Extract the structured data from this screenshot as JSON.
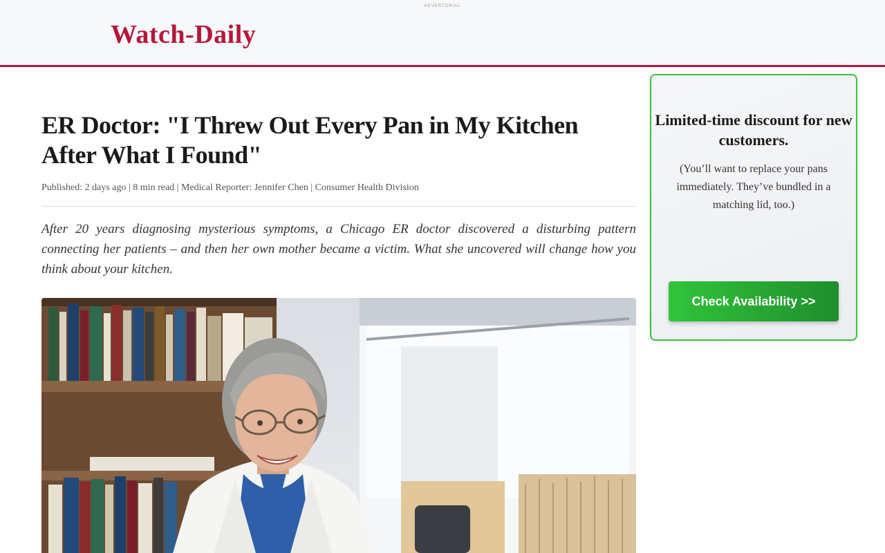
{
  "header": {
    "advertorial_label": "ADVERTORIAL",
    "logo": "Watch-Daily",
    "brand_color": "#b5173a"
  },
  "article": {
    "title": "ER Doctor: \"I Threw Out Every Pan in My Kitchen After What I Found\"",
    "byline": "Published: 2 days ago | 8 min read | Medical Reporter: Jennifer Chen | Consumer Health Division",
    "lede": "After 20 years diagnosing mysterious symptoms, a Chicago ER doctor discovered a disturbing pattern connecting her patients – and then her own mother became a victim. What she uncovered will change how you think about your kitchen."
  },
  "sidebar": {
    "headline": "Limited-time discount for new customers.",
    "body": "(You’ll want to replace your pans immediately. They’ve bundled in a matching lid, too.)",
    "cta_label": "Check Availability >>",
    "cta_color": "#2aa836"
  }
}
